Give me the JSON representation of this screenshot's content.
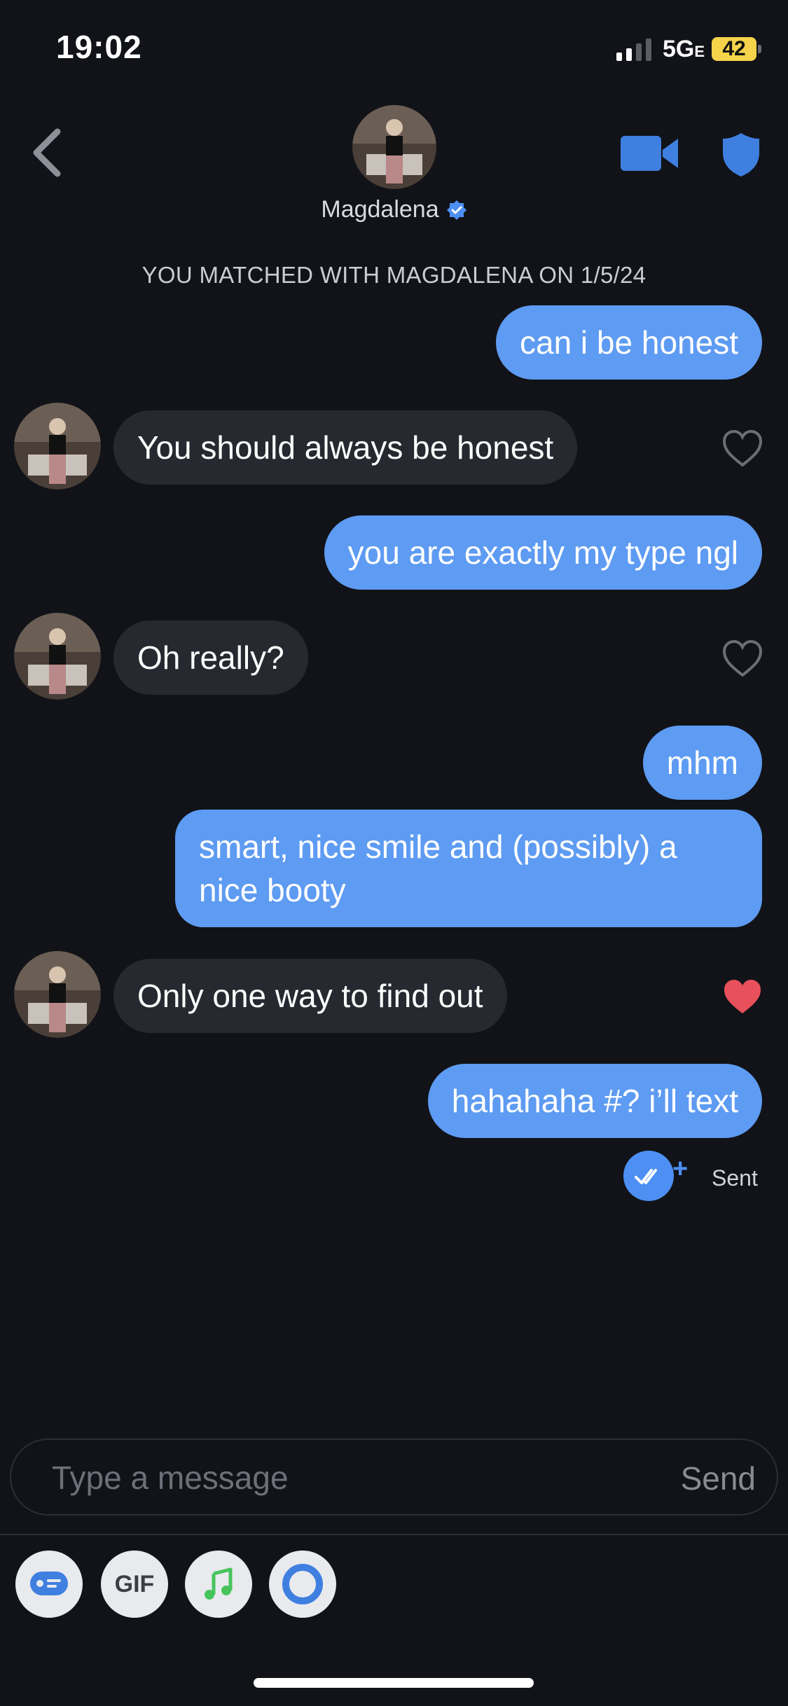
{
  "status_bar": {
    "time": "19:02",
    "network": "5G",
    "network_suffix": "E",
    "battery": "42"
  },
  "header": {
    "name": "Magdalena",
    "verified": true
  },
  "match_note": "YOU MATCHED WITH MAGDALENA ON 1/5/24",
  "messages": [
    {
      "from": "me",
      "text": "can i be honest"
    },
    {
      "from": "them",
      "text": "You should always be honest",
      "liked": false
    },
    {
      "from": "me",
      "text": "you are exactly my type ngl"
    },
    {
      "from": "them",
      "text": "Oh really?",
      "liked": false
    },
    {
      "from": "me",
      "text": "mhm"
    },
    {
      "from": "me",
      "text_line1": "smart, nice smile and (possibly) a",
      "text_line2": "nice booty"
    },
    {
      "from": "them",
      "text": "Only one way to find out",
      "liked": true
    },
    {
      "from": "me",
      "text": "hahahaha #? i’ll text"
    }
  ],
  "receipt": {
    "status": "Sent"
  },
  "composer": {
    "placeholder": "Type a message",
    "send_label": "Send"
  },
  "toolbar": {
    "gif_label": "GIF"
  },
  "colors": {
    "outgoing": "#5e9bf2",
    "incoming": "#26292f",
    "background": "#111318",
    "heart_liked": "#e8505b",
    "accent": "#4d8ff3"
  }
}
